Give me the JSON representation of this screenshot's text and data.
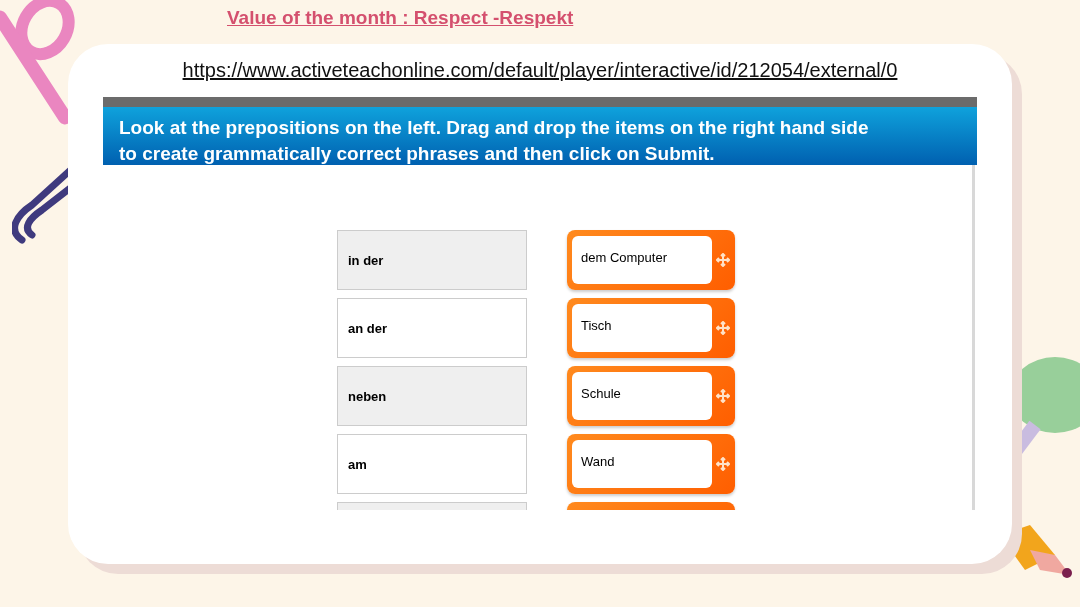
{
  "slide_title": "Value of the month : Respect -Respekt",
  "link": "https://www.activeteachonline.com/default/player/interactive/id/212054/external/0",
  "activity": {
    "instructions": "Look at the prepositions on the left. Drag and drop the items on the right hand side to create grammatically correct phrases and then click on Submit.",
    "prepositions": [
      "in der",
      "an der",
      "neben",
      "am"
    ],
    "items": [
      "dem Computer",
      "Tisch",
      "Schule",
      "Wand"
    ]
  }
}
